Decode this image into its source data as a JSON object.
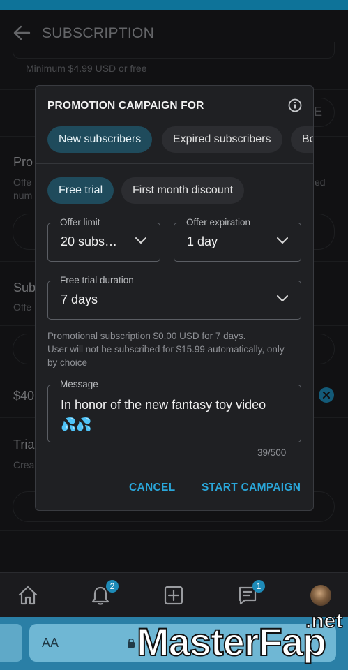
{
  "header": {
    "title": "SUBSCRIPTION"
  },
  "background": {
    "min_note": "Minimum $4.99 USD or free",
    "btn_fragment": "E",
    "row1_head": "Pro",
    "row1_sub1": "Offe",
    "row1_sub2": "num",
    "row1_right": "ed",
    "row2_head": "Sub",
    "row2_sub": "Offe",
    "price_fragment": "$40",
    "row3_head": "Tria",
    "row3_sub": "Crea"
  },
  "dialog": {
    "title": "PROMOTION CAMPAIGN FOR",
    "audience_tabs": [
      {
        "label": "New subscribers",
        "selected": true
      },
      {
        "label": "Expired subscribers",
        "selected": false
      },
      {
        "label": "Bo",
        "selected": false
      }
    ],
    "type_tabs": [
      {
        "label": "Free trial",
        "selected": true
      },
      {
        "label": "First month discount",
        "selected": false
      }
    ],
    "offer_limit": {
      "label": "Offer limit",
      "value": "20 subs…"
    },
    "offer_expiration": {
      "label": "Offer expiration",
      "value": "1 day"
    },
    "trial_duration": {
      "label": "Free trial duration",
      "value": "7 days"
    },
    "hint_line1": "Promotional subscription $0.00 USD for 7 days.",
    "hint_line2": "User will not be subscribed for $15.99 automatically, only",
    "hint_line3": "by choice",
    "message": {
      "label": "Message",
      "line1": "In honor of the new fantasy toy video",
      "line2": "💦💦",
      "counter": "39/500"
    },
    "cancel_label": "CANCEL",
    "start_label": "START CAMPAIGN"
  },
  "nav": {
    "notifications_count": "2",
    "messages_count": "1"
  },
  "browser": {
    "aa_label": "AA"
  },
  "watermark": {
    "main": "MasterFap",
    "suffix": ".net"
  },
  "colors": {
    "accent": "#2aa6d9",
    "chip_selected": "#1f4b5c",
    "status_strip": "#16b1ec"
  }
}
